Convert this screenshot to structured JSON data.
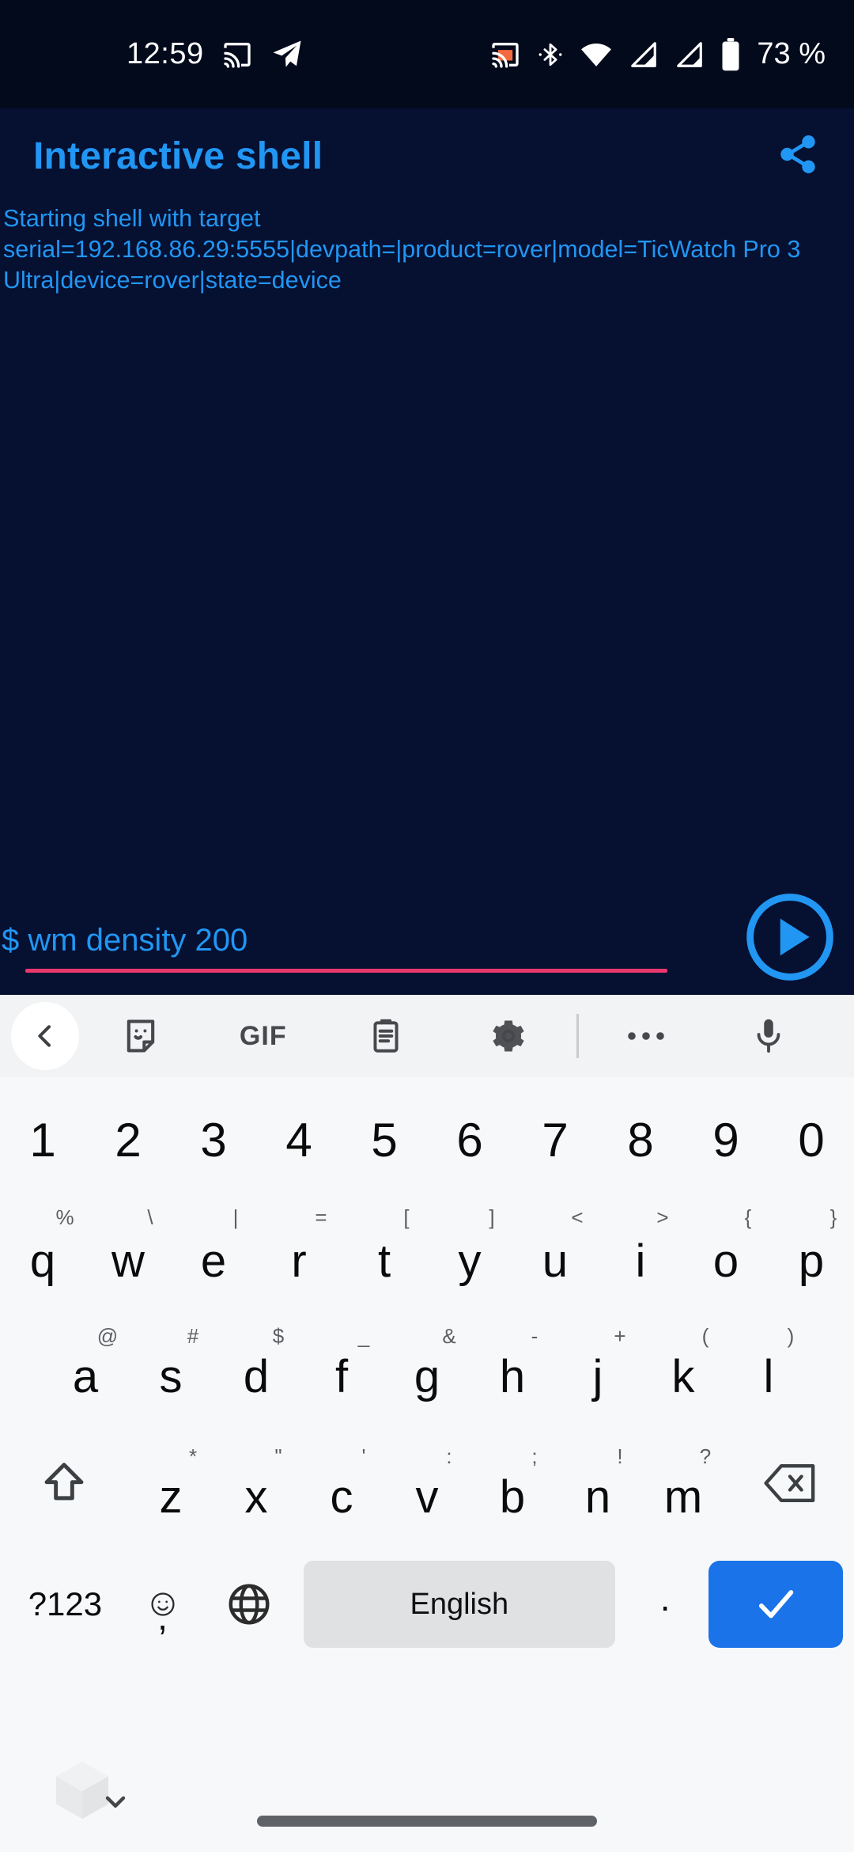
{
  "status_bar": {
    "time": "12:59",
    "battery_text": "73 %",
    "icons": [
      "cast-icon",
      "telegram-icon",
      "cast-active-icon",
      "bluetooth-icon",
      "wifi-icon",
      "signal-1-icon",
      "signal-2-icon",
      "battery-icon"
    ],
    "colors": {
      "background": "#030a1c",
      "foreground": "#ffffff",
      "cast_active": "#f46a3f"
    }
  },
  "app": {
    "title": "Interactive shell",
    "share_icon": "share-icon",
    "console_output": "Starting shell with target serial=192.168.86.29:5555|devpath=|product=rover|model=TicWatch Pro 3 Ultra|device=rover|state=device",
    "input": {
      "prompt": "$",
      "value": "wm density 200",
      "placeholder": "",
      "underline_color": "#e8386d"
    },
    "send_button_label": "send-play-icon",
    "colors": {
      "background": "#061031",
      "accent": "#2196f3"
    }
  },
  "keyboard": {
    "toolbar": [
      {
        "name": "back-chevron-icon",
        "label": ""
      },
      {
        "name": "sticker-icon",
        "label": ""
      },
      {
        "name": "gif-icon",
        "label": "GIF"
      },
      {
        "name": "clipboard-icon",
        "label": ""
      },
      {
        "name": "gear-icon",
        "label": ""
      },
      {
        "name": "divider",
        "label": ""
      },
      {
        "name": "more-dots-icon",
        "label": ""
      },
      {
        "name": "microphone-icon",
        "label": ""
      }
    ],
    "rows": {
      "numbers": [
        {
          "main": "1",
          "sup": ""
        },
        {
          "main": "2",
          "sup": ""
        },
        {
          "main": "3",
          "sup": ""
        },
        {
          "main": "4",
          "sup": ""
        },
        {
          "main": "5",
          "sup": ""
        },
        {
          "main": "6",
          "sup": ""
        },
        {
          "main": "7",
          "sup": ""
        },
        {
          "main": "8",
          "sup": ""
        },
        {
          "main": "9",
          "sup": ""
        },
        {
          "main": "0",
          "sup": ""
        }
      ],
      "qwerty": [
        {
          "main": "q",
          "sup": "%"
        },
        {
          "main": "w",
          "sup": "\\"
        },
        {
          "main": "e",
          "sup": "|"
        },
        {
          "main": "r",
          "sup": "="
        },
        {
          "main": "t",
          "sup": "["
        },
        {
          "main": "y",
          "sup": "]"
        },
        {
          "main": "u",
          "sup": "<"
        },
        {
          "main": "i",
          "sup": ">"
        },
        {
          "main": "o",
          "sup": "{"
        },
        {
          "main": "p",
          "sup": "}"
        }
      ],
      "asdf": [
        {
          "main": "a",
          "sup": "@"
        },
        {
          "main": "s",
          "sup": "#"
        },
        {
          "main": "d",
          "sup": "$"
        },
        {
          "main": "f",
          "sup": "_"
        },
        {
          "main": "g",
          "sup": "&"
        },
        {
          "main": "h",
          "sup": "-"
        },
        {
          "main": "j",
          "sup": "+"
        },
        {
          "main": "k",
          "sup": "("
        },
        {
          "main": "l",
          "sup": ")"
        }
      ],
      "zxcv": [
        {
          "main": "z",
          "sup": "*"
        },
        {
          "main": "x",
          "sup": "\""
        },
        {
          "main": "c",
          "sup": "'"
        },
        {
          "main": "v",
          "sup": ":"
        },
        {
          "main": "b",
          "sup": ";"
        },
        {
          "main": "n",
          "sup": "!"
        },
        {
          "main": "m",
          "sup": "?"
        }
      ]
    },
    "shift_key": "shift-icon",
    "backspace_key": "backspace-icon",
    "bottom": {
      "symbols_label": "?123",
      "comma_label": ",",
      "emoji_icon": "emoji-icon",
      "globe_icon": "globe-icon",
      "space_label": "English",
      "period_label": ".",
      "enter_icon": "checkmark-icon"
    },
    "colors": {
      "background": "#f7f8fa",
      "toolbar": "#f1f3f5",
      "space": "#dfe1e3",
      "enter": "#1a73e8",
      "key_text": "#0b0b0b",
      "sup_text": "#5c5e62"
    }
  },
  "navbar": {
    "cube_icon": "cube-icon",
    "chevron_icon": "chevron-down-icon",
    "home_pill": "home-gesture-pill"
  }
}
